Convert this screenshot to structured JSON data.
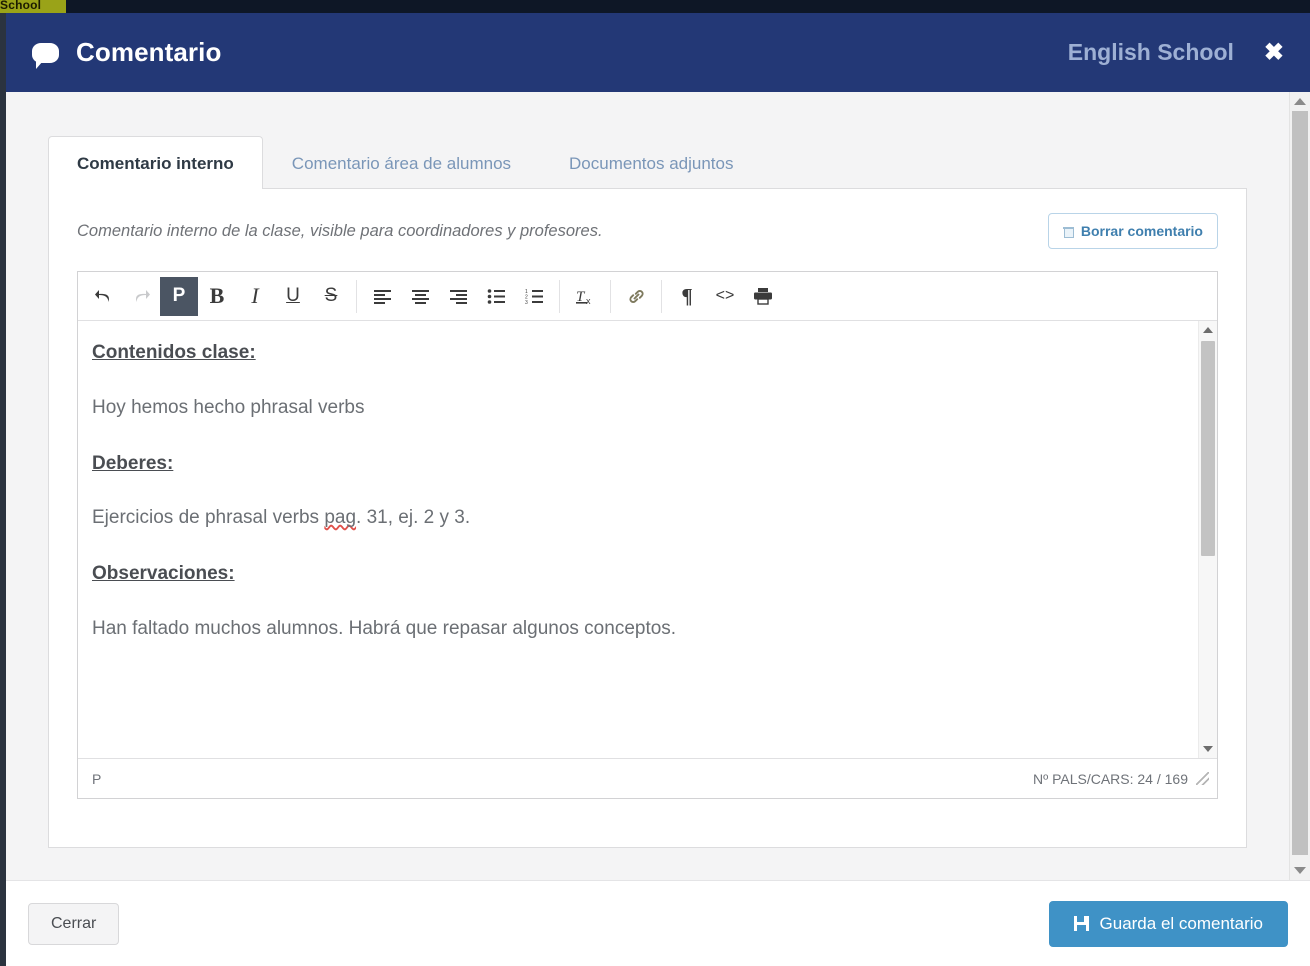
{
  "background": {
    "school_tag": "School"
  },
  "header": {
    "icon": "comment-bubble-icon",
    "title": "Comentario",
    "school_name": "English School",
    "close_label": "✖",
    "bg_color": "#233876"
  },
  "tabs": [
    {
      "label": "Comentario interno",
      "active": true
    },
    {
      "label": "Comentario área de alumnos",
      "active": false
    },
    {
      "label": "Documentos adjuntos",
      "active": false
    }
  ],
  "panel": {
    "description": "Comentario interno de la clase, visible para coordinadores y profesores.",
    "delete_button": {
      "label": "Borrar comentario",
      "icon": "trash-icon",
      "color": "#3f7fae"
    }
  },
  "editor": {
    "toolbar": [
      {
        "name": "undo-icon",
        "glyph": "↶",
        "state": "enabled"
      },
      {
        "name": "redo-icon",
        "glyph": "↷",
        "state": "disabled"
      },
      {
        "name": "paragraph-format-button",
        "glyph": "P",
        "state": "active"
      },
      {
        "name": "bold-icon",
        "glyph": "B",
        "state": "enabled"
      },
      {
        "name": "italic-icon",
        "glyph": "I",
        "state": "enabled"
      },
      {
        "name": "underline-icon",
        "glyph": "U",
        "state": "enabled"
      },
      {
        "name": "strikethrough-icon",
        "glyph": "S",
        "state": "enabled"
      },
      {
        "name": "align-left-icon",
        "glyph": "",
        "state": "enabled"
      },
      {
        "name": "align-center-icon",
        "glyph": "",
        "state": "enabled"
      },
      {
        "name": "align-right-icon",
        "glyph": "",
        "state": "enabled"
      },
      {
        "name": "bullet-list-icon",
        "glyph": "",
        "state": "enabled"
      },
      {
        "name": "numbered-list-icon",
        "glyph": "",
        "state": "enabled"
      },
      {
        "name": "clear-formatting-icon",
        "glyph": "",
        "state": "enabled"
      },
      {
        "name": "link-icon",
        "glyph": "",
        "state": "enabled"
      },
      {
        "name": "pilcrow-icon",
        "glyph": "¶",
        "state": "enabled"
      },
      {
        "name": "source-code-icon",
        "glyph": "<>",
        "state": "enabled"
      },
      {
        "name": "print-icon",
        "glyph": "",
        "state": "enabled"
      }
    ],
    "content": [
      {
        "text": "Contenidos clase:",
        "style": "heading"
      },
      {
        "text": "Hoy hemos hecho phrasal verbs",
        "style": "body"
      },
      {
        "text": "Deberes:",
        "style": "heading"
      },
      {
        "text": "Ejercicios de phrasal verbs ",
        "style": "body",
        "misspelled": "pag",
        "tail": ". 31, ej. 2 y 3."
      },
      {
        "text": "Observaciones:",
        "style": "heading"
      },
      {
        "text": "Han faltado muchos alumnos. Habrá que repasar algunos conceptos.",
        "style": "body"
      }
    ],
    "status": {
      "element_path": "P",
      "counter": "Nº PALS/CARS: 24 / 169"
    }
  },
  "footer": {
    "close_label": "Cerrar",
    "save_label": "Guarda el comentario",
    "save_icon": "save-floppy-icon",
    "save_color": "#3f92c6"
  }
}
